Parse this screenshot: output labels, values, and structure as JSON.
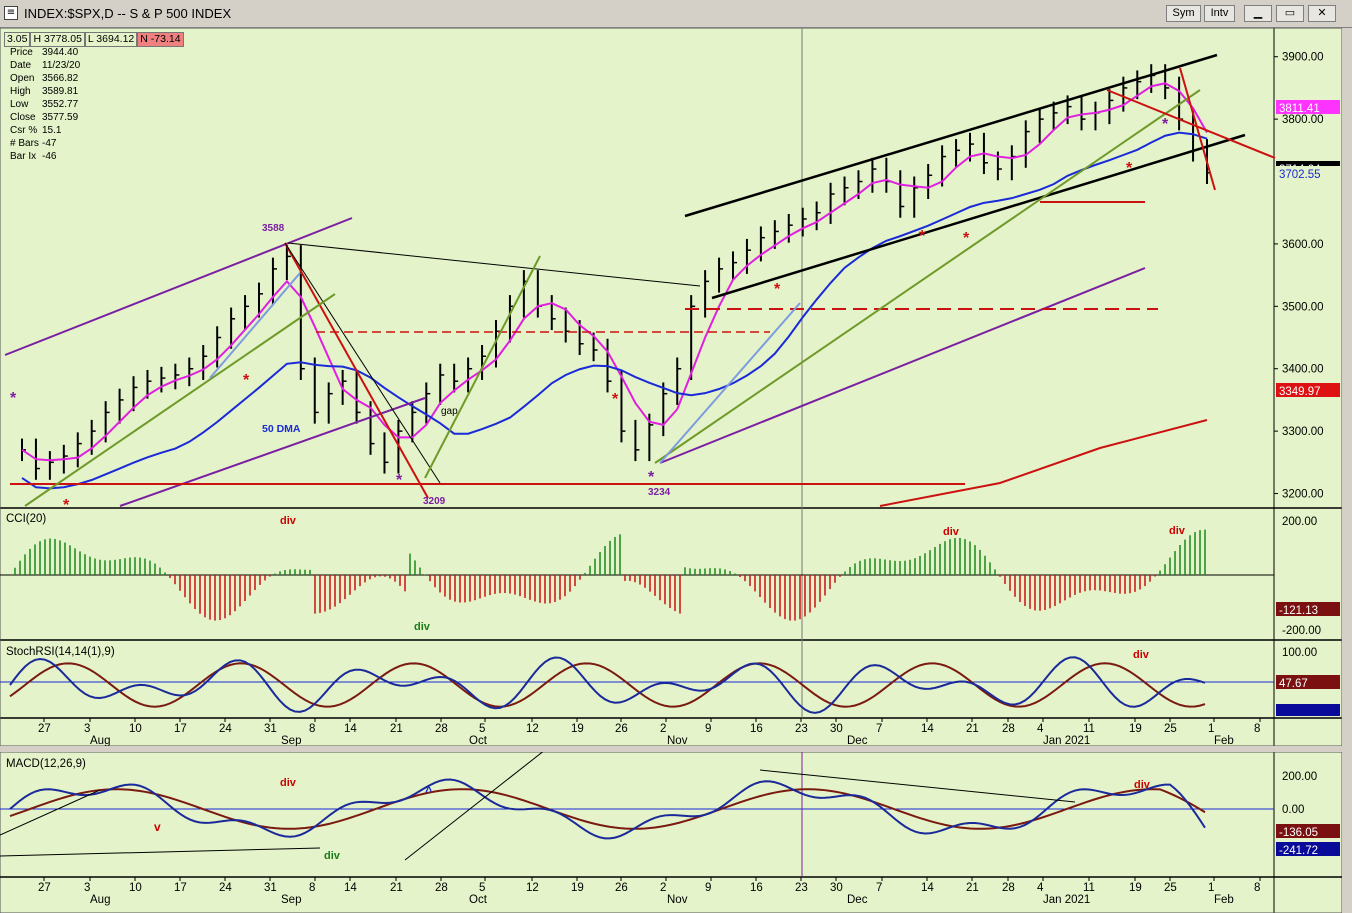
{
  "window": {
    "title": "INDEX:$SPX,D -- S & P 500 INDEX",
    "buttons": [
      "Sym",
      "Intv"
    ]
  },
  "ohlc_strip": [
    {
      "label": "",
      "value": "3.05"
    },
    {
      "label": "H",
      "value": "3778.05"
    },
    {
      "label": "L",
      "value": "3694.12"
    },
    {
      "label": "N",
      "value": "-73.14",
      "negative": true
    }
  ],
  "info_box": [
    {
      "label": "Price",
      "value": "3944.40"
    },
    {
      "label": "Date",
      "value": "11/23/20"
    },
    {
      "label": "Open",
      "value": "3566.82"
    },
    {
      "label": "High",
      "value": "3589.81"
    },
    {
      "label": "Low",
      "value": "3552.77"
    },
    {
      "label": "Close",
      "value": "3577.59"
    },
    {
      "label": "Csr %",
      "value": "15.1"
    },
    {
      "label": "# Bars",
      "value": "-47"
    },
    {
      "label": "Bar Ix",
      "value": "-46"
    }
  ],
  "colors": {
    "background": "#e4f3c9",
    "bars": "#000000",
    "ma20": "#e01fe0",
    "ma50": "#1a2ad8",
    "ma200": "#cc1111",
    "channel": "#7b1fa2",
    "trend_green": "#6f9a2a",
    "cci_pos": "#1b8a1b",
    "cci_neg": "#cc1111",
    "stoch_fast": "#1a2a9a",
    "stoch_slow": "#7a1a10"
  },
  "annotations": {
    "ma50_label": "50 DMA",
    "gap_label": "gap",
    "high_3588": "3588",
    "low_3209": "3209",
    "low_3234": "3234",
    "div_labels": [
      "div",
      "div",
      "div",
      "div"
    ],
    "cci_div_green": "div",
    "stoch_div": "div",
    "macd_div_red": "div",
    "macd_div_green": "div",
    "macd_div_right": "div",
    "macd_v": "v",
    "macd_caret": "^"
  },
  "chart_data": [
    {
      "type": "bar",
      "subtype": "ohlc",
      "title": "INDEX:$SPX,D -- S & P 500 INDEX",
      "y_ticks": [
        "3900.00",
        "3800.00",
        "3600.00",
        "3500.00",
        "3400.00",
        "3300.00",
        "3200.00"
      ],
      "ylim": [
        3180,
        3930
      ],
      "price_labels": [
        {
          "text": "3811.41",
          "color": "#ff33ff"
        },
        {
          "text": "3714.24",
          "color": "#000000"
        },
        {
          "text": "3702.55",
          "color": "#1a2ad8"
        },
        {
          "text": "3349.97",
          "color": "#dd1111"
        }
      ],
      "x_ticks": [
        "27",
        "3",
        "10",
        "17",
        "24",
        "31",
        "8",
        "14",
        "21",
        "28",
        "5",
        "12",
        "19",
        "26",
        "2",
        "9",
        "16",
        "23",
        "30",
        "7",
        "14",
        "21",
        "28",
        "4",
        "11",
        "19",
        "25",
        "1",
        "8"
      ],
      "month_labels": [
        "Aug",
        "Sep",
        "Oct",
        "Nov",
        "Dec",
        "Jan 2021",
        "Feb"
      ],
      "closes_approx": [
        3270,
        3240,
        3250,
        3260,
        3280,
        3300,
        3330,
        3350,
        3370,
        3380,
        3385,
        3390,
        3400,
        3420,
        3450,
        3480,
        3500,
        3520,
        3560,
        3580,
        3400,
        3330,
        3360,
        3380,
        3330,
        3280,
        3250,
        3300,
        3330,
        3360,
        3390,
        3380,
        3400,
        3420,
        3460,
        3500,
        3540,
        3500,
        3480,
        3460,
        3440,
        3430,
        3380,
        3300,
        3270,
        3310,
        3360,
        3400,
        3500,
        3540,
        3560,
        3570,
        3590,
        3610,
        3620,
        3630,
        3640,
        3650,
        3680,
        3690,
        3700,
        3720,
        3700,
        3660,
        3690,
        3710,
        3740,
        3750,
        3760,
        3730,
        3720,
        3740,
        3780,
        3800,
        3810,
        3820,
        3800,
        3810,
        3830,
        3850,
        3860,
        3870,
        3850,
        3800,
        3750,
        3714
      ]
    },
    {
      "type": "bar",
      "name": "CCI(20)",
      "y_ticks": [
        "200.00",
        "-200.00"
      ],
      "ylim": [
        -250,
        250
      ],
      "value_label": "-121.13"
    },
    {
      "type": "line",
      "name": "StochRSI(14,14(1),9)",
      "y_ticks": [
        "100.00"
      ],
      "ylim": [
        0,
        100
      ],
      "value_label": "47.67"
    },
    {
      "type": "line",
      "name": "MACD(12,26,9)",
      "y_ticks": [
        "200.00",
        "0.00"
      ],
      "ylim": [
        -350,
        300
      ],
      "value_labels": [
        "-136.05",
        "-241.72"
      ]
    }
  ]
}
